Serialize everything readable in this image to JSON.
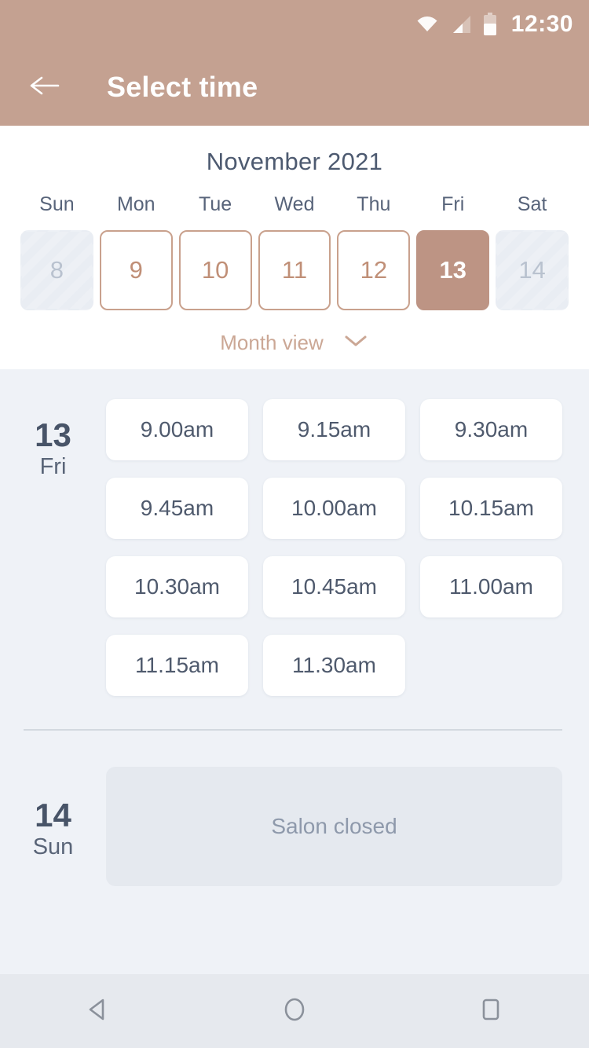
{
  "statusbar": {
    "time": "12:30",
    "wifi_icon": "wifi-icon",
    "signal_icon": "signal-icon",
    "battery_icon": "battery-icon"
  },
  "appbar": {
    "back_icon": "back-arrow-icon",
    "title": "Select time"
  },
  "calendar": {
    "month_title": "November 2021",
    "weekdays": [
      "Sun",
      "Mon",
      "Tue",
      "Wed",
      "Thu",
      "Fri",
      "Sat"
    ],
    "days": [
      {
        "num": "8",
        "state": "disabled"
      },
      {
        "num": "9",
        "state": "enabled"
      },
      {
        "num": "10",
        "state": "enabled"
      },
      {
        "num": "11",
        "state": "enabled"
      },
      {
        "num": "12",
        "state": "enabled"
      },
      {
        "num": "13",
        "state": "selected"
      },
      {
        "num": "14",
        "state": "disabled"
      }
    ],
    "month_view_label": "Month view",
    "chevron_icon": "chevron-down-icon"
  },
  "schedule": [
    {
      "day_number": "13",
      "day_name": "Fri",
      "slots": [
        "9.00am",
        "9.15am",
        "9.30am",
        "9.45am",
        "10.00am",
        "10.15am",
        "10.30am",
        "10.45am",
        "11.00am",
        "11.15am",
        "11.30am"
      ]
    },
    {
      "day_number": "14",
      "day_name": "Sun",
      "closed_label": "Salon closed"
    }
  ],
  "navbar": {
    "back_icon": "nav-back-icon",
    "home_icon": "nav-home-icon",
    "recents_icon": "nav-recents-icon"
  },
  "colors": {
    "accent": "#c4a191",
    "selected_day": "#bd9484",
    "day_border": "#c9a18d",
    "body_bg": "#eff2f7",
    "text_dark": "#4d5a70"
  }
}
